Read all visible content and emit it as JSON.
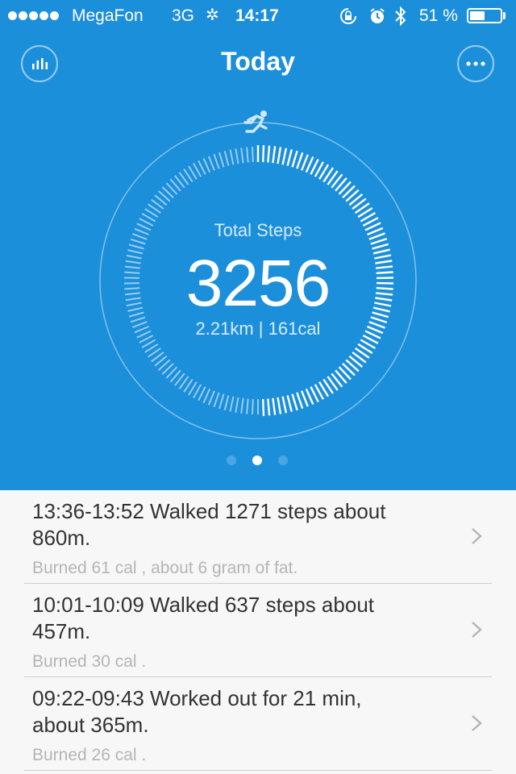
{
  "status": {
    "carrier": "MegaFon",
    "network": "3G",
    "time": "14:17",
    "battery_pct": "51 %",
    "battery_level": 0.51,
    "icons": [
      "signal-dots-icon",
      "activity-spinner-icon",
      "rotation-lock-icon",
      "alarm-icon",
      "bluetooth-icon",
      "battery-icon"
    ]
  },
  "header": {
    "title": "Today",
    "left_icon": "bar-chart-icon",
    "right_icon": "more-options-icon",
    "top_icon": "running-person-icon"
  },
  "summary": {
    "label": "Total Steps",
    "steps": "3256",
    "details": "2.21km | 161cal"
  },
  "pager": {
    "count": 3,
    "active": 1
  },
  "activities": [
    {
      "line1": "13:36-13:52  Walked 1271 steps about",
      "line2": "860m.",
      "sub": "Burned 61 cal , about 6 gram of fat."
    },
    {
      "line1": "10:01-10:09  Walked 637 steps about",
      "line2": "457m.",
      "sub": "Burned 30 cal ."
    },
    {
      "line1": "09:22-09:43  Worked out for 21 min,",
      "line2": "about 365m.",
      "sub": "Burned 26 cal ."
    }
  ],
  "colors": {
    "header_bg": "#1c8fdb",
    "list_bg": "#f7f7f7",
    "text": "#333333",
    "muted": "#b5b5b5"
  }
}
